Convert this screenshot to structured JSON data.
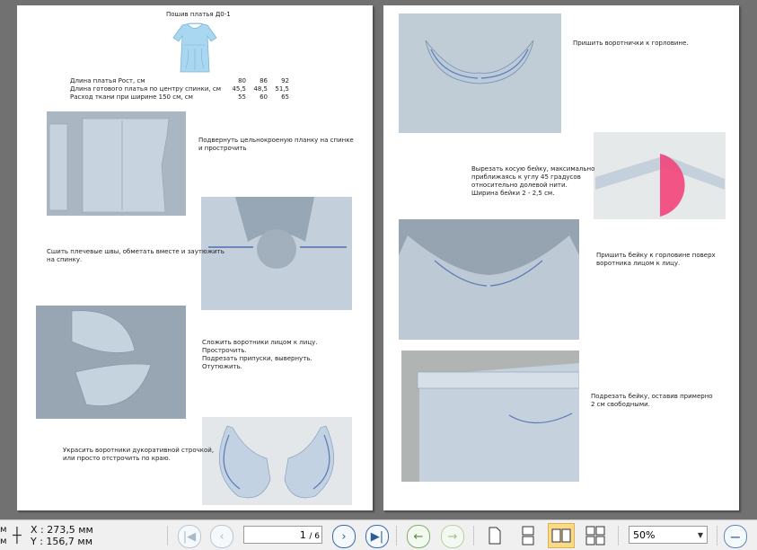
{
  "page1": {
    "title": "Пошив платья Д0-1",
    "spec_rows": [
      {
        "label": "Длина платья Рост, см",
        "values": [
          "80",
          "86",
          "92"
        ]
      },
      {
        "label": "Длина готового платья по центру спинки, см",
        "values": [
          "45,5",
          "48,5",
          "51,5"
        ]
      },
      {
        "label": "Расход ткани при ширине 150 см, см",
        "values": [
          "55",
          "60",
          "65"
        ]
      }
    ],
    "step1": "Подвернуть цельнокроеную планку на спинке\nи прострочить",
    "step2": "Сшить плечевые швы, обметать вместе и заутюжить\nна спинку.",
    "step3": "Сложить воротники лицом к лицу.\nПрострочить.\nПодрезать припуски, вывернуть.\nОтутюжить.",
    "step4": "Украсить воротники дукоративной строчкой,\nили просто отстрочить по краю."
  },
  "page2": {
    "step1": "Пришить воротнички к горловине.",
    "step2": "Вырезать косую бейку, максимально\nприближаясь к углу 45 градусов\nотносительно долевой нити.\nШирина бейки 2 - 2,5 см.",
    "step3": "Пришить бейку к горловине поверх\nворотника лицом к лицу.",
    "step4": "Подрезать бейку, оставив примерно\n2 см свободными."
  },
  "statusbar": {
    "unit_left": "м\nм",
    "x": "X : 273,5 мм",
    "y": "Y : 156,7 мм",
    "page_current": "1",
    "page_total": "/ 6",
    "zoom": "50%"
  },
  "icons": {
    "first": "first-page-icon",
    "prev": "prev-page-icon",
    "next": "next-page-icon",
    "last": "last-page-icon",
    "back": "back-icon",
    "forward": "forward-icon",
    "single": "single-page-view-icon",
    "continuous": "continuous-view-icon",
    "facing": "facing-view-icon",
    "grid": "grid-view-icon",
    "zoom_out": "zoom-out-icon"
  }
}
